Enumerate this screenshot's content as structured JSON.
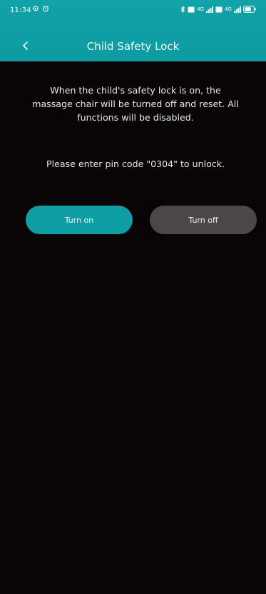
{
  "status_bar": {
    "time": "11:34",
    "network_labels": [
      "4G",
      "4G"
    ],
    "icons": [
      "alarm-icon",
      "bluetooth-icon",
      "hd-icon",
      "signal-icon",
      "hd-icon",
      "signal-icon",
      "battery-icon"
    ]
  },
  "header": {
    "title": "Child Safety Lock",
    "back_icon": "chevron-left-icon"
  },
  "main": {
    "description": "When the child's safety lock is on, the massage chair will be turned off and reset. All functions will be disabled.",
    "pin_instruction": "Please enter pin code \"0304\" to unlock.",
    "turn_on_label": "Turn on",
    "turn_off_label": "Turn off"
  },
  "colors": {
    "accent": "#0f9ea3",
    "background": "#070405",
    "button_off": "#4a4748"
  }
}
